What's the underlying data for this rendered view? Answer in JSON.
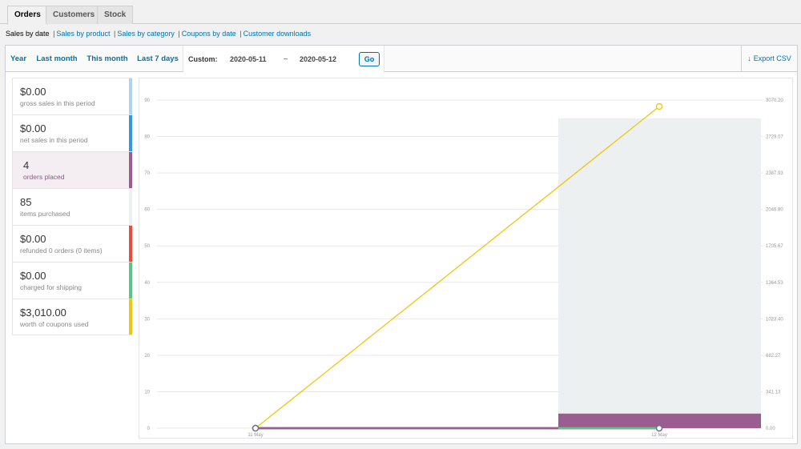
{
  "tabs": [
    {
      "label": "Orders",
      "active": true
    },
    {
      "label": "Customers",
      "active": false
    },
    {
      "label": "Stock",
      "active": false
    }
  ],
  "subnav": {
    "current": "Sales by date",
    "links": [
      "Sales by product",
      "Sales by category",
      "Coupons by date",
      "Customer downloads"
    ]
  },
  "range": {
    "buttons": [
      "Year",
      "Last month",
      "This month",
      "Last 7 days"
    ],
    "custom_label": "Custom:",
    "start_date": "2020-05-11",
    "dash": "–",
    "end_date": "2020-05-12",
    "go_label": "Go",
    "export_label": "Export CSV",
    "export_icon": "download-icon"
  },
  "legend": [
    {
      "value": "$0.00",
      "label": "gross sales in this period",
      "color": "#b1d4ea"
    },
    {
      "value": "$0.00",
      "label": "net sales in this period",
      "color": "#3498db"
    },
    {
      "value": "4",
      "label": "orders placed",
      "color": "#9b5c8f",
      "highlighted": true
    },
    {
      "value": "85",
      "label": "items purchased",
      "color": "#ecf0f1"
    },
    {
      "value": "$0.00",
      "label": "refunded 0 orders (0 items)",
      "color": "#e74c3c"
    },
    {
      "value": "$0.00",
      "label": "charged for shipping",
      "color": "#5cc488"
    },
    {
      "value": "$3,010.00",
      "label": "worth of coupons used",
      "color": "#f1c40f"
    }
  ],
  "chart_data": {
    "type": "bar",
    "x": [
      "11 May",
      "12 May"
    ],
    "y_left_ticks": [
      "0",
      "10",
      "20",
      "30",
      "40",
      "50",
      "60",
      "70",
      "80",
      "90"
    ],
    "y_right_ticks": [
      "0.00",
      "341.13",
      "682.27",
      "1023.40",
      "1364.53",
      "1705.67",
      "2046.80",
      "2387.93",
      "2729.07",
      "3070.20"
    ],
    "ylim_left": [
      0,
      90
    ],
    "ylim_right": [
      0,
      3070.2
    ],
    "series": [
      {
        "name": "items purchased",
        "type": "bar",
        "axis": "left",
        "color": "#ecf0f1",
        "values": [
          0,
          85
        ]
      },
      {
        "name": "orders placed",
        "type": "bar",
        "axis": "left",
        "color": "#9b5c8f",
        "values": [
          0,
          4
        ]
      },
      {
        "name": "worth of coupons used",
        "type": "line",
        "axis": "right",
        "color": "#f1c40f",
        "values": [
          0,
          3010
        ]
      },
      {
        "name": "gross sales in this period",
        "type": "line",
        "axis": "right",
        "color": "#b1d4ea",
        "values": [
          0,
          0
        ]
      },
      {
        "name": "net sales in this period",
        "type": "line",
        "axis": "right",
        "color": "#3498db",
        "values": [
          0,
          0
        ]
      },
      {
        "name": "refunded 0 orders (0 items)",
        "type": "line",
        "axis": "right",
        "color": "#e74c3c",
        "values": [
          0,
          0
        ]
      },
      {
        "name": "charged for shipping",
        "type": "line",
        "axis": "right",
        "color": "#5cc488",
        "values": [
          0,
          0
        ]
      }
    ],
    "grid": true
  }
}
